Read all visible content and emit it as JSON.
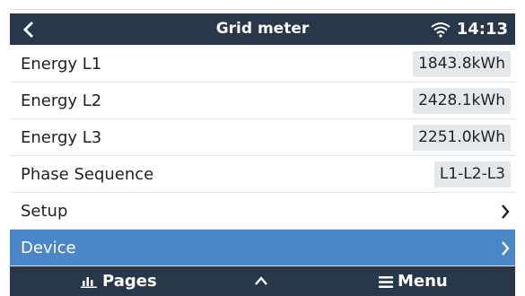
{
  "header": {
    "title": "Grid meter",
    "time": "14:13",
    "back_icon": "chevron-left-icon",
    "status_icon": "wifi-icon"
  },
  "rows": [
    {
      "label": "Energy L1",
      "value": "1843.8kWh"
    },
    {
      "label": "Energy L2",
      "value": "2428.1kWh"
    },
    {
      "label": "Energy L3",
      "value": "2251.0kWh"
    },
    {
      "label": "Phase Sequence",
      "value": "L1-L2-L3"
    },
    {
      "label": "Setup"
    },
    {
      "label": "Device",
      "selected": true
    }
  ],
  "footer": {
    "pages_label": "Pages",
    "menu_label": "Menu"
  },
  "colors": {
    "header_bg": "#28374a",
    "selected_row": "#4a86c8",
    "value_badge": "#e5e8ea"
  }
}
